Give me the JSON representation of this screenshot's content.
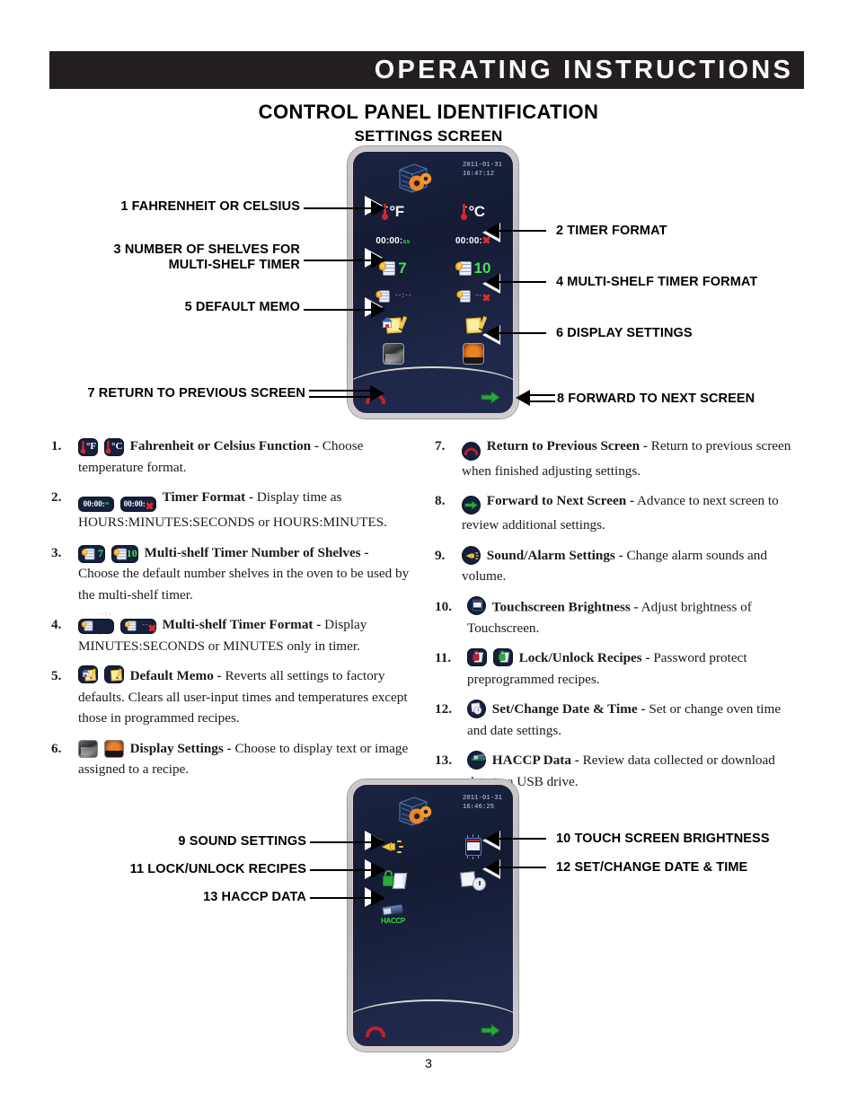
{
  "header": {
    "banner_title": "OPERATING INSTRUCTIONS"
  },
  "titles": {
    "main": "CONTROL PANEL IDENTIFICATION",
    "sub": "SETTINGS SCREEN"
  },
  "panel_one": {
    "date": "2011-01-31",
    "time": "16:47:12",
    "temp_f": "°F",
    "temp_c": "°C",
    "timer_full": "00:00:",
    "timer_full_seconds": "ss",
    "timer_short": "00:00:",
    "shelves_left": "7",
    "shelves_right": "10",
    "shelf_format_left": "--:--",
    "shelf_format_right": "--"
  },
  "panel_two": {
    "date": "2011-01-31",
    "time": "16:46:25",
    "haccp_label": "HACCP"
  },
  "callouts_top": [
    {
      "id": "c1",
      "text": "1 FAHRENHEIT OR CELSIUS"
    },
    {
      "id": "c3",
      "line1": "3 NUMBER OF SHELVES FOR",
      "line2": "MULTI-SHELF TIMER"
    },
    {
      "id": "c5",
      "text": "5 DEFAULT MEMO"
    },
    {
      "id": "c7",
      "text": "7 RETURN TO PREVIOUS SCREEN"
    },
    {
      "id": "c2",
      "text": "2 TIMER FORMAT"
    },
    {
      "id": "c4",
      "text": "4 MULTI-SHELF TIMER FORMAT"
    },
    {
      "id": "c6",
      "text": "6 DISPLAY SETTINGS"
    },
    {
      "id": "c8",
      "text": "8 FORWARD TO NEXT SCREEN"
    }
  ],
  "callouts_bottom": [
    {
      "id": "c9",
      "text": "9 SOUND SETTINGS"
    },
    {
      "id": "c11",
      "text": "11 LOCK/UNLOCK RECIPES"
    },
    {
      "id": "c13",
      "text": "13 HACCP DATA"
    },
    {
      "id": "c10",
      "text": "10 TOUCH SCREEN BRIGHTNESS"
    },
    {
      "id": "c12",
      "text": "12 SET/CHANGE DATE & TIME"
    }
  ],
  "descriptions": {
    "left": [
      {
        "num": "1.",
        "title": "Fahrenheit or Celsius Function -",
        "body": " Choose temperature format."
      },
      {
        "num": "2.",
        "title": "Timer Format -",
        "body": " Display time as HOURS:MINUTES:SECONDS or HOURS:MINUTES."
      },
      {
        "num": "3.",
        "title": "Multi-shelf Timer Number of Shelves -",
        "body": " Choose the default number shelves in the oven to be used by the multi-shelf timer."
      },
      {
        "num": "4.",
        "title": "Multi-shelf Timer Format -",
        "body": " Display MINUTES:SECONDS or MINUTES only in timer."
      },
      {
        "num": "5.",
        "title": "Default Memo -",
        "body": " Reverts all settings to factory defaults. Clears all user-input times and temperatures except those in programmed recipes."
      },
      {
        "num": "6.",
        "title": "Display Settings -",
        "body": " Choose to display text or image assigned to a recipe."
      }
    ],
    "right": [
      {
        "num": "7.",
        "title": "Return to Previous Screen -",
        "body": " Return to previous screen when finished adjusting settings."
      },
      {
        "num": "8.",
        "title": "Forward to Next Screen -",
        "body": " Advance to next screen to review additional settings."
      },
      {
        "num": "9.",
        "title": "Sound/Alarm Settings -",
        "body": " Change alarm sounds and volume."
      },
      {
        "num": "10.",
        "title": "Touchscreen Brightness -",
        "body": " Adjust brightness of Touchscreen."
      },
      {
        "num": "11.",
        "title": "Lock/Unlock Recipes -",
        "body": " Password protect preprogrammed recipes."
      },
      {
        "num": "12.",
        "title": "Set/Change Date & Time -",
        "body": " Set or change oven time and date settings."
      },
      {
        "num": "13.",
        "title": "HACCP Data -",
        "body": " Review data collected or download data to a USB drive."
      }
    ]
  },
  "footer": {
    "page_number": "3"
  },
  "colors": {
    "banner_bg": "#231f20",
    "screen_navy": "#141b33",
    "bezel": "#c2c2c7",
    "green_accent": "#3fd23f",
    "red_accent": "#d8242f",
    "gear_orange": "#f0861f"
  }
}
